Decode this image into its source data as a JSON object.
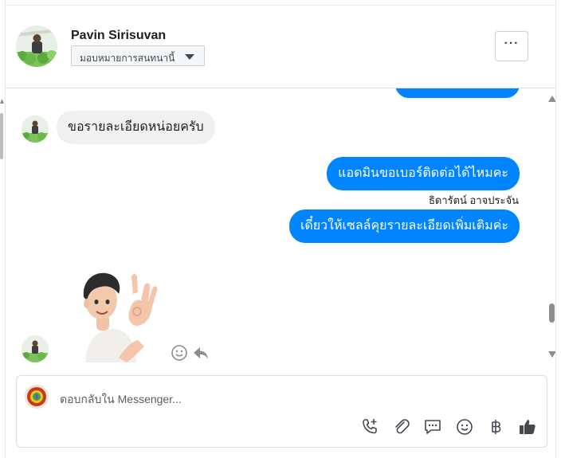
{
  "header": {
    "name": "Pavin Sirisuvan",
    "assign_label": "มอบหมายการสนทนานี้",
    "more_label": "···"
  },
  "messages": [
    {
      "side": "in",
      "text": "ขอรายละเอียดหน่อยครับ"
    },
    {
      "side": "out",
      "text": "แอดมินขอเบอร์ติดต่อได้ไหมคะ"
    },
    {
      "side": "out",
      "sender": "ธิดารัตน์ อาจประจัน",
      "text": "เดี๋ยวให้เซลล์คุยรายละเอียดเพิ่มเติมค่ะ"
    }
  ],
  "composer": {
    "placeholder": "ตอบกลับใน Messenger..."
  },
  "icons": {
    "header": [
      "profile-avatar",
      "caret-down-icon",
      "more-options-icon"
    ],
    "messages": [
      "smile-react-icon",
      "reply-icon",
      "ok-hand-sticker"
    ],
    "toolbar": [
      "add-call-icon",
      "paperclip-icon",
      "saved-replies-icon",
      "emoji-icon",
      "baht-payment-icon",
      "thumbs-up-icon"
    ]
  },
  "colors": {
    "accent": "#0084ff",
    "incoming_bubble": "#f0f0f0",
    "text": "#1c1e21"
  }
}
